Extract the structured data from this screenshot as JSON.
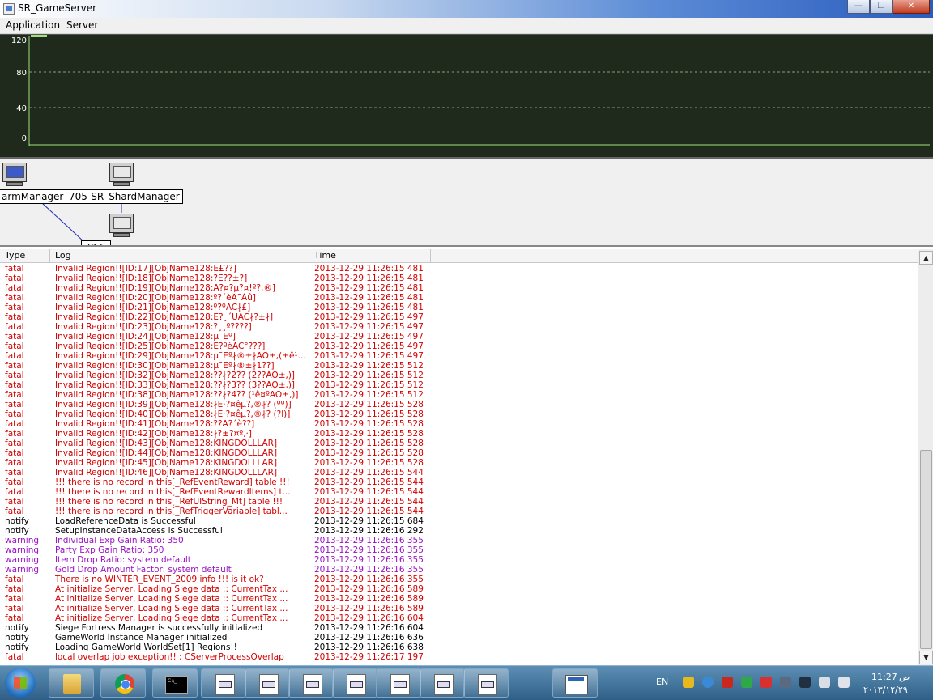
{
  "window": {
    "title": "SR_GameServer",
    "btn_min": "—",
    "btn_max": "❐",
    "btn_close": "✕"
  },
  "menu": {
    "items": [
      "Application",
      "Server"
    ]
  },
  "graph": {
    "y_ticks": [
      "120",
      "80",
      "40",
      "0"
    ],
    "line_color": "#9ee27a",
    "background": "#1f2a1c"
  },
  "diagram": {
    "nodes": [
      "armManager",
      "705-SR_ShardManager",
      "707_"
    ]
  },
  "log": {
    "columns": [
      "Type",
      "Log",
      "Time"
    ],
    "colors": {
      "fatal": "#d40000",
      "warning": "#9a12c4",
      "notify": "#000000"
    },
    "rows": [
      {
        "type": "fatal",
        "log": "Invalid Region!![ID:17][ObjName128:E£??]",
        "time": "2013-12-29 11:26:15 481"
      },
      {
        "type": "fatal",
        "log": "Invalid Region!![ID:18][ObjName128:?E??±?]",
        "time": "2013-12-29 11:26:15 481"
      },
      {
        "type": "fatal",
        "log": "Invalid Region!![ID:19][ObjName128:A?¤?µ?¤!º?,®]",
        "time": "2013-12-29 11:26:15 481"
      },
      {
        "type": "fatal",
        "log": "Invalid Region!![ID:20][ObjName128:º?´èÄ¯Àû]",
        "time": "2013-12-29 11:26:15 481"
      },
      {
        "type": "fatal",
        "log": "Invalid Region!![ID:21][ObjName128:º?ºAC∤£]",
        "time": "2013-12-29 11:26:15 481"
      },
      {
        "type": "fatal",
        "log": "Invalid Region!![ID:22][ObjName128:E?¸´UAC∤?±∤]",
        "time": "2013-12-29 11:26:15 497"
      },
      {
        "type": "fatal",
        "log": "Invalid Region!![ID:23][ObjName128:?¸¸º????]",
        "time": "2013-12-29 11:26:15 497"
      },
      {
        "type": "fatal",
        "log": "Invalid Region!![ID:24][ObjName128:µ¯Eº]",
        "time": "2013-12-29 11:26:15 497"
      },
      {
        "type": "fatal",
        "log": "Invalid Region!![ID:25][ObjName128:E?ºèAC°???]",
        "time": "2013-12-29 11:26:15 497"
      },
      {
        "type": "fatal",
        "log": "Invalid Region!![ID:29][ObjName128:µ¯Eº∤®±∤AO±,(±ê¹...",
        "time": "2013-12-29 11:26:15 497"
      },
      {
        "type": "fatal",
        "log": "Invalid Region!![ID:30][ObjName128:µ¯Eº∤®±∤1??]",
        "time": "2013-12-29 11:26:15 512"
      },
      {
        "type": "fatal",
        "log": "Invalid Region!![ID:32][ObjName128:??∤?2?? (2??AO±,)]",
        "time": "2013-12-29 11:26:15 512"
      },
      {
        "type": "fatal",
        "log": "Invalid Region!![ID:33][ObjName128:??∤?3?? (3??AO±,)]",
        "time": "2013-12-29 11:26:15 512"
      },
      {
        "type": "fatal",
        "log": "Invalid Region!![ID:38][ObjName128:??∤?4?? (¹ê¤ºAO±,)]",
        "time": "2013-12-29 11:26:15 512"
      },
      {
        "type": "fatal",
        "log": "Invalid Region!![ID:39][ObjName128:∤E·?¤êµ?,®∤? (ºº)]",
        "time": "2013-12-29 11:26:15 528"
      },
      {
        "type": "fatal",
        "log": "Invalid Region!![ID:40][ObjName128:∤E·?¤êµ?,®∤? (?l)]",
        "time": "2013-12-29 11:26:15 528"
      },
      {
        "type": "fatal",
        "log": "Invalid Region!![ID:41][ObjName128:??A?´è??]",
        "time": "2013-12-29 11:26:15 528"
      },
      {
        "type": "fatal",
        "log": "Invalid Region!![ID:42][ObjName128:∤?±?¤º,·]",
        "time": "2013-12-29 11:26:15 528"
      },
      {
        "type": "fatal",
        "log": "Invalid Region!![ID:43][ObjName128:KINGDOLLLAR]",
        "time": "2013-12-29 11:26:15 528"
      },
      {
        "type": "fatal",
        "log": "Invalid Region!![ID:44][ObjName128:KINGDOLLLAR]",
        "time": "2013-12-29 11:26:15 528"
      },
      {
        "type": "fatal",
        "log": "Invalid Region!![ID:45][ObjName128:KINGDOLLLAR]",
        "time": "2013-12-29 11:26:15 528"
      },
      {
        "type": "fatal",
        "log": "Invalid Region!![ID:46][ObjName128:KINGDOLLLAR]",
        "time": "2013-12-29 11:26:15 544"
      },
      {
        "type": "fatal",
        "log": "!!! there is no record in this[_RefEventReward] table !!!",
        "time": "2013-12-29 11:26:15 544"
      },
      {
        "type": "fatal",
        "log": "!!! there is no record in this[_RefEventRewardItems] t...",
        "time": "2013-12-29 11:26:15 544"
      },
      {
        "type": "fatal",
        "log": "!!! there is no record in this[_RefUIString_Mt] table !!!",
        "time": "2013-12-29 11:26:15 544"
      },
      {
        "type": "fatal",
        "log": "!!! there is no record in this[_RefTriggerVariable] tabl...",
        "time": "2013-12-29 11:26:15 544"
      },
      {
        "type": "notify",
        "log": "LoadReferenceData is Successful",
        "time": "2013-12-29 11:26:15 684"
      },
      {
        "type": "notify",
        "log": "SetupInstanceDataAccess is Successful",
        "time": "2013-12-29 11:26:16 292"
      },
      {
        "type": "warning",
        "log": "Individual Exp Gain Ratio: 350",
        "time": "2013-12-29 11:26:16 355"
      },
      {
        "type": "warning",
        "log": "Party Exp Gain Ratio: 350",
        "time": "2013-12-29 11:26:16 355"
      },
      {
        "type": "warning",
        "log": "Item Drop Ratio: system default",
        "time": "2013-12-29 11:26:16 355"
      },
      {
        "type": "warning",
        "log": "Gold Drop Amount Factor: system default",
        "time": "2013-12-29 11:26:16 355"
      },
      {
        "type": "fatal",
        "log": "There is no WINTER_EVENT_2009 info !!! is it ok?",
        "time": "2013-12-29 11:26:16 355"
      },
      {
        "type": "fatal",
        "log": "At initialize Server, Loading Siege data :: CurrentTax ...",
        "time": "2013-12-29 11:26:16 589"
      },
      {
        "type": "fatal",
        "log": "At initialize Server, Loading Siege data :: CurrentTax ...",
        "time": "2013-12-29 11:26:16 589"
      },
      {
        "type": "fatal",
        "log": "At initialize Server, Loading Siege data :: CurrentTax ...",
        "time": "2013-12-29 11:26:16 589"
      },
      {
        "type": "fatal",
        "log": "At initialize Server, Loading Siege data :: CurrentTax ...",
        "time": "2013-12-29 11:26:16 604"
      },
      {
        "type": "notify",
        "log": "Siege Fortress Manager is successfully initialized",
        "time": "2013-12-29 11:26:16 604"
      },
      {
        "type": "notify",
        "log": "GameWorld Instance Manager initialized",
        "time": "2013-12-29 11:26:16 636"
      },
      {
        "type": "notify",
        "log": "Loading GameWorld WorldSet[1] Regions!!",
        "time": "2013-12-29 11:26:16 638"
      },
      {
        "type": "fatal",
        "log": "local overlap job exception!! : CServerProcessOverlap",
        "time": "2013-12-29 11:26:17 197"
      }
    ]
  },
  "scroll": {
    "up": "▲",
    "down": "▼"
  },
  "taskbar": {
    "lang": "EN",
    "time": "11:27",
    "ampm": "ص",
    "date": "٢٠١٣/١٢/٢٩",
    "buttons": [
      "folder-icon",
      "chrome-icon",
      "cmd-icon",
      "window-doc-icon",
      "window-doc-icon",
      "window-doc-icon",
      "window-doc-icon",
      "window-doc-icon",
      "window-doc-icon",
      "window-doc-icon",
      "app-window-icon"
    ]
  }
}
